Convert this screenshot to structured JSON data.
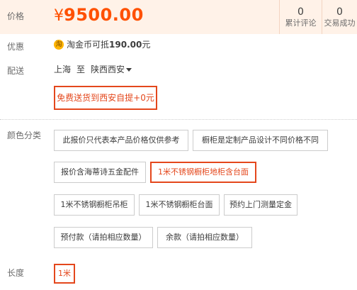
{
  "price": {
    "label": "价格",
    "currency": "¥",
    "amount": "9500.00"
  },
  "stats": [
    {
      "count": "0",
      "label": "累计评论"
    },
    {
      "count": "0",
      "label": "交易成功"
    }
  ],
  "promo": {
    "label": "优惠",
    "icon": "taojinbi-coin-icon",
    "icon_glyph": "淘",
    "text_prefix": "淘金币可抵",
    "amount": "190.00",
    "unit": "元"
  },
  "delivery": {
    "label": "配送",
    "origin": "上海",
    "to": "至",
    "destination": "陕西西安",
    "option": "免费送货到西安自提+0元"
  },
  "color": {
    "label": "颜色分类",
    "options": [
      {
        "text": "此报价只代表本产品价格仅供参考",
        "selected": false
      },
      {
        "text": "橱柜是定制产品设计不同价格不同",
        "selected": false
      },
      {
        "text": "报价含海蒂诗五金配件",
        "selected": false
      },
      {
        "text": "1米不锈钢橱柜地柜含台面",
        "selected": true
      },
      {
        "text": "1米不锈钢橱柜吊柜",
        "selected": false
      },
      {
        "text": "1米不锈钢橱柜台面",
        "selected": false
      },
      {
        "text": "预约上门测量定金",
        "selected": false
      },
      {
        "text": "预付款（请拍相应数量）",
        "selected": false
      },
      {
        "text": "余款（请拍相应数量）",
        "selected": false
      }
    ]
  },
  "length": {
    "label": "长度",
    "options": [
      {
        "text": "1米",
        "selected": true
      }
    ]
  },
  "colors": {
    "accent": "#ff5000",
    "selected_border": "#e4471c",
    "price_band": "#fff2e8"
  }
}
